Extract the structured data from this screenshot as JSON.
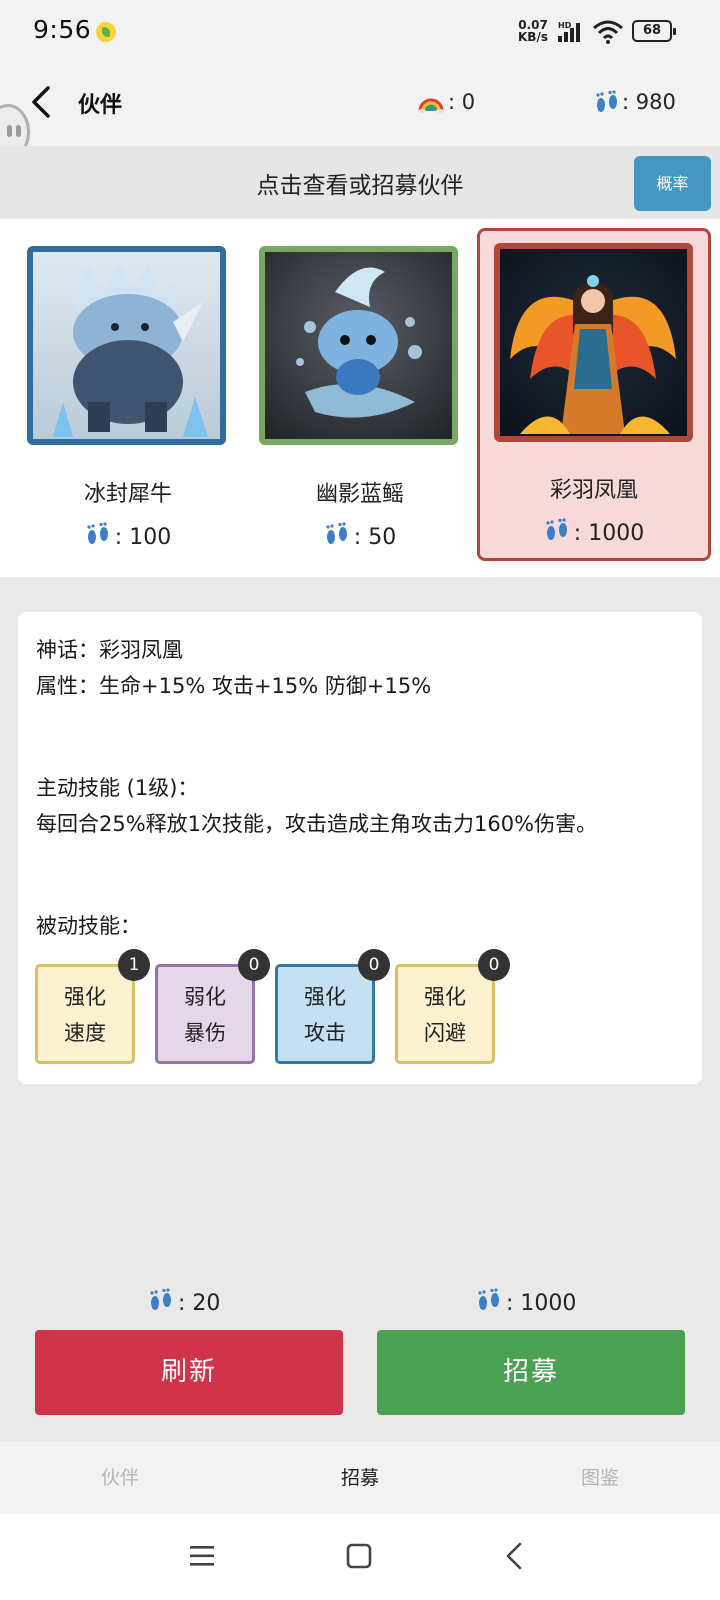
{
  "status_bar": {
    "time": "9:56",
    "net_speed_value": "0.07",
    "net_speed_unit": "KB/s",
    "network_type": "HD",
    "battery": "68"
  },
  "header": {
    "title": "伙伴",
    "rainbow_value": "0",
    "footprint_value": "980",
    "separator": ":"
  },
  "recruit": {
    "title": "点击查看或招募伙伴",
    "probability_button": "概率"
  },
  "partners": [
    {
      "name": "冰封犀牛",
      "cost": "100",
      "frame_color": "#2f6da0",
      "selected": false
    },
    {
      "name": "幽影蓝鳐",
      "cost": "50",
      "frame_color": "#78a862",
      "selected": false
    },
    {
      "name": "彩羽凤凰",
      "cost": "1000",
      "frame_color": "#b0473d",
      "selected": true
    }
  ],
  "details": {
    "rarity_line": "神话：彩羽凤凰",
    "attributes_line": "属性：生命+15% 攻击+15% 防御+15%",
    "active_skill_title": "主动技能 (1级)：",
    "active_skill_desc": "每回合25%释放1次技能，攻击造成主角攻击力160%伤害。",
    "passive_skill_title": "被动技能：",
    "passive_skills": [
      {
        "line1": "强化",
        "line2": "速度",
        "count": "1",
        "bg": "#fdf2cf",
        "border": "#d9bf62"
      },
      {
        "line1": "弱化",
        "line2": "暴伤",
        "count": "0",
        "bg": "#e5d7ea",
        "border": "#9474a8"
      },
      {
        "line1": "强化",
        "line2": "攻击",
        "count": "0",
        "bg": "#c4e1f4",
        "border": "#3677a8"
      },
      {
        "line1": "强化",
        "line2": "闪避",
        "count": "0",
        "bg": "#fdf2cf",
        "border": "#d9bf62"
      }
    ]
  },
  "actions": {
    "refresh_cost": "20",
    "refresh_label": "刷新",
    "recruit_cost": "1000",
    "recruit_label": "招募",
    "refresh_color": "#d1344a",
    "recruit_color": "#4aa153"
  },
  "tabs": [
    {
      "label": "伙伴",
      "active": false
    },
    {
      "label": "招募",
      "active": true
    },
    {
      "label": "图鉴",
      "active": false
    }
  ],
  "icons": {
    "status": [
      "signal-icon",
      "wifi-icon",
      "battery-icon"
    ],
    "currency": [
      "rainbow-icon",
      "footprint-icon"
    ],
    "nav": [
      "back-icon",
      "menu-icon",
      "home-icon",
      "back-nav-icon"
    ]
  }
}
